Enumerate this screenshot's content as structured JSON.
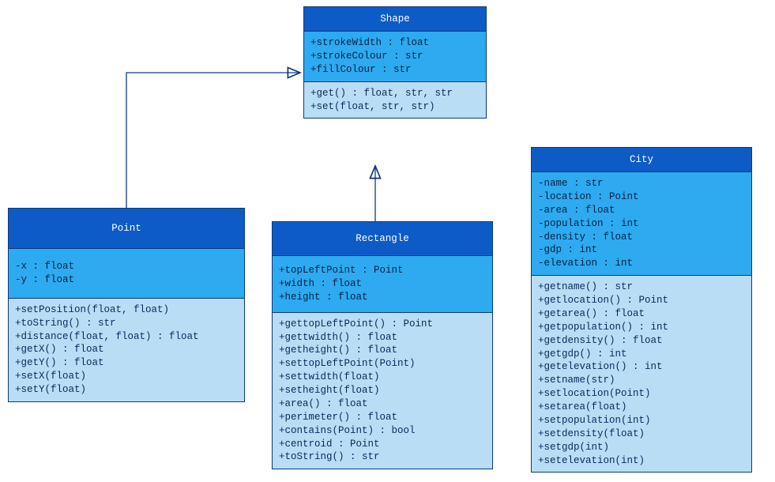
{
  "classes": {
    "shape": {
      "name": "Shape",
      "attrs": "+strokeWidth : float\n+strokeColour : str\n+fillColour : str",
      "methods": "+get() : float, str, str\n+set(float, str, str)"
    },
    "point": {
      "name": "Point",
      "attrs": "-x : float\n-y : float",
      "methods": "+setPosition(float, float)\n+toString() : str\n+distance(float, float) : float\n+getX() : float\n+getY() : float\n+setX(float)\n+setY(float)"
    },
    "rectangle": {
      "name": "Rectangle",
      "attrs": "+topLeftPoint : Point\n+width : float\n+height : float",
      "methods": "+gettopLeftPoint() : Point\n+gettwidth() : float\n+getheight() : float\n+settopLeftPoint(Point)\n+settwidth(float)\n+setheight(float)\n+area() : float\n+perimeter() : float\n+contains(Point) : bool\n+centroid : Point\n+toString() : str"
    },
    "city": {
      "name": "City",
      "attrs": "-name : str\n-location : Point\n-area : float\n-population : int\n-density : float\n-gdp : int\n-elevation : int",
      "methods": "+getname() : str\n+getlocation() : Point\n+getarea() : float\n+getpopulation() : int\n+getdensity() : float\n+getgdp() : int\n+getelevation() : int\n+setname(str)\n+setlocation(Point)\n+setarea(float)\n+setpopulation(int)\n+setdensity(float)\n+setgdp(int)\n+setelevation(int)"
    }
  }
}
